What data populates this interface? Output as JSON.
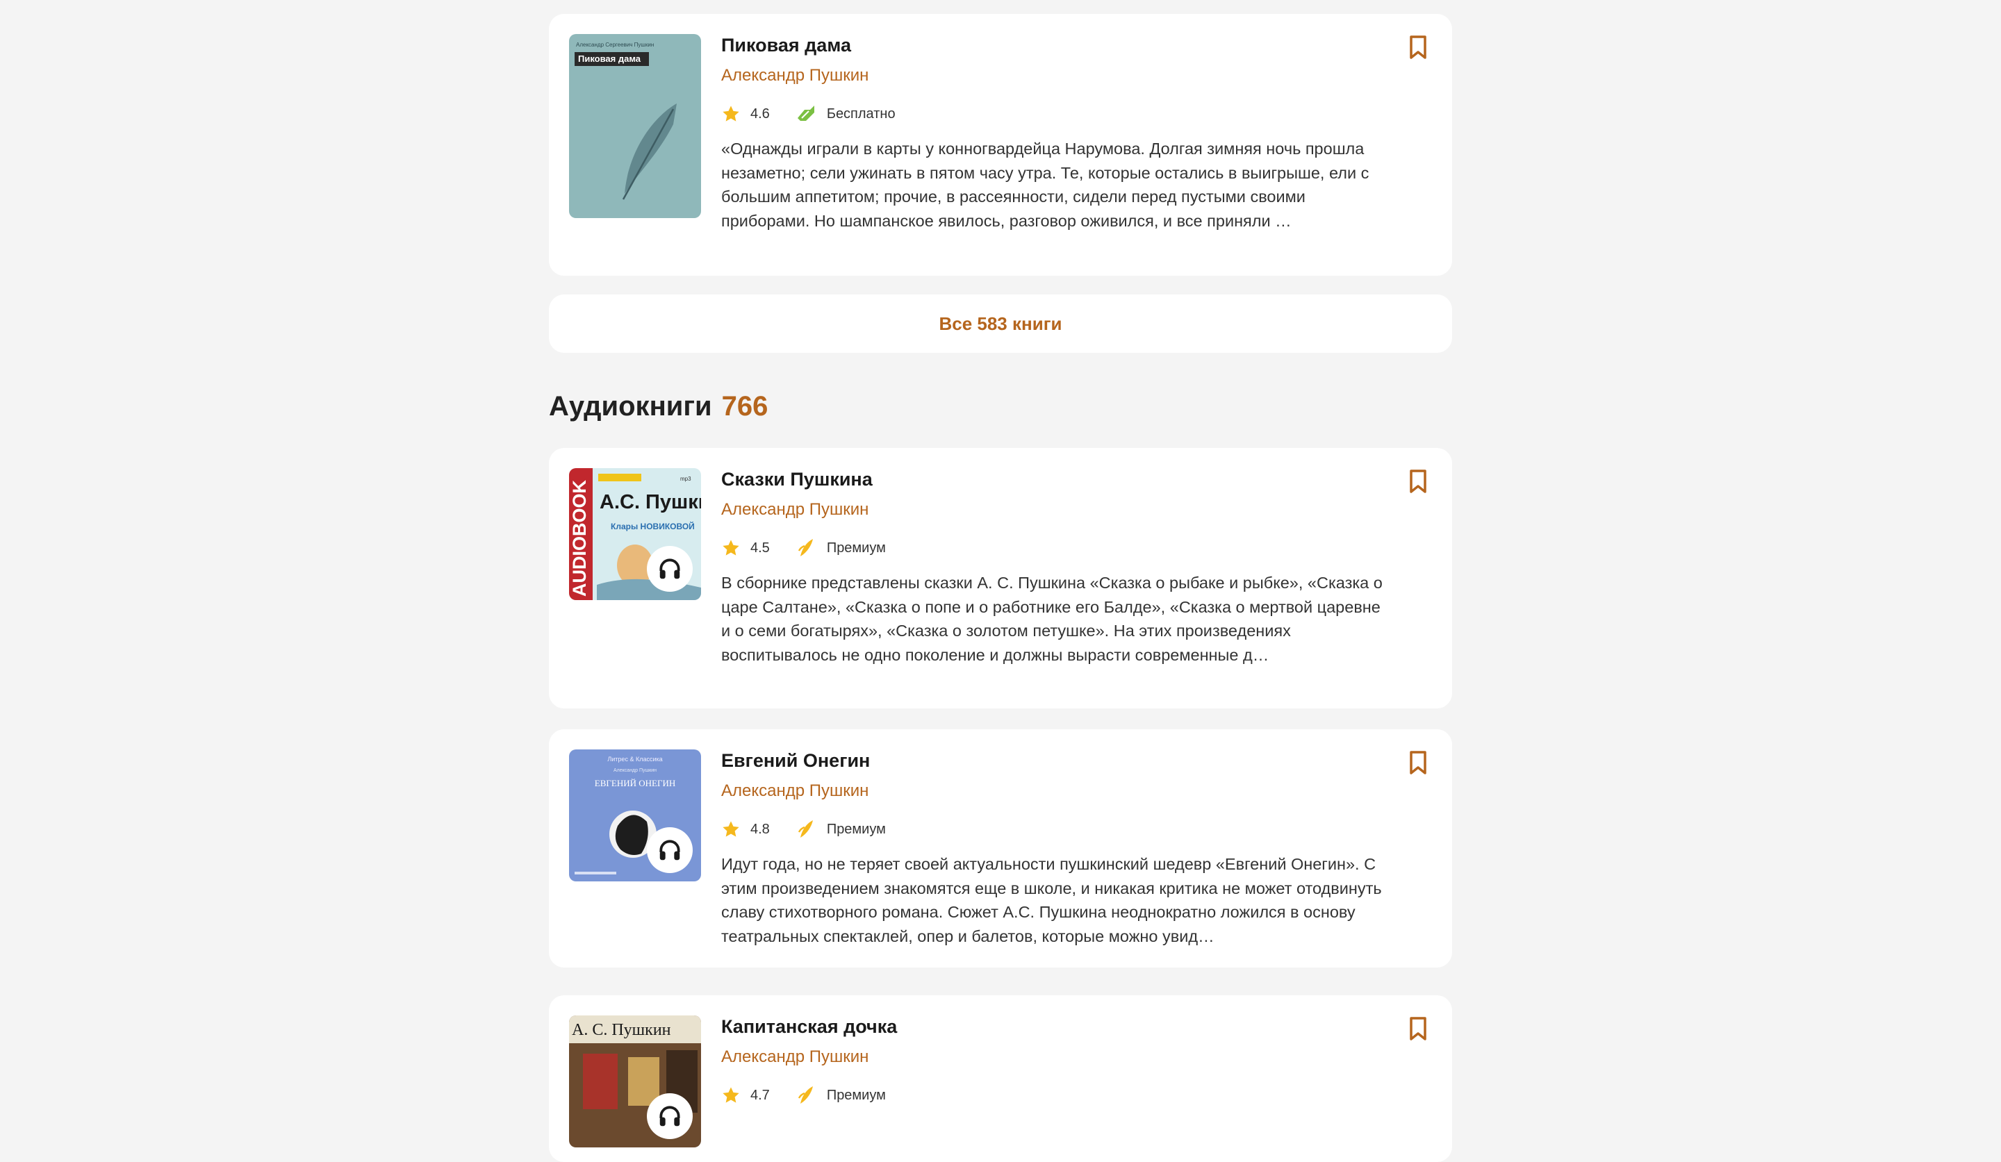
{
  "colors": {
    "accent": "#b5651d",
    "star": "#f5b81d",
    "free_badge": "#7bc043",
    "premium_badge": "#f5b81d",
    "background": "#f4f4f4"
  },
  "books_section": {
    "book": {
      "title": "Пиковая дама",
      "author": "Александр Пушкин",
      "rating": "4.6",
      "badge_icon": "free-icon",
      "badge_label": "Бесплатно",
      "description": "«Однажды играли в карты у конногвардейца Нарумова. Долгая зимняя ночь прошла незаметно; сели ужинать в пятом часу утра. Те, которые остались в выигрыше, ели с большим аппетитом; прочие, в рассеянности, сидели перед пустыми своими приборами. Но шампанское явилось, разговор оживился, и все приняли …",
      "cover": {
        "top_text": "Александр Сергеевич Пушкин",
        "label": "Пиковая дама"
      }
    },
    "all_books_label": "Все 583 книги"
  },
  "audiobooks_section": {
    "heading": "Аудиокниги",
    "count": "766",
    "items": [
      {
        "title": "Сказки Пушкина",
        "author": "Александр Пушкин",
        "rating": "4.5",
        "badge_icon": "premium-icon",
        "badge_label": "Премиум",
        "description": "В сборнике представлены сказки А. С. Пушкина «Сказка о рыбаке и рыбке», «Сказка о царе Салтане», «Сказка о попе и о работнике его Балде», «Сказка о мертвой царевне и о семи богатырях», «Сказка о золотом петушке». На этих произведениях воспитывалось не одно поколение и должны вырасти современные д…",
        "cover": {
          "side_text": "AUDIOBOOK",
          "name": "А.С. Пушкин",
          "subtitle": "Клары НОВИКОВОЙ",
          "mp3": "mp3"
        }
      },
      {
        "title": "Евгений Онегин",
        "author": "Александр Пушкин",
        "rating": "4.8",
        "badge_icon": "premium-icon",
        "badge_label": "Премиум",
        "description": "Идут года, но не теряет своей актуальности пушкинский шедевр «Евгений Онегин». С этим произведением знакомятся еще в школе, и никакая критика не может отодвинуть славу стихотворного романа. Сюжет А.С. Пушкина неоднократно ложился в основу театральных спектаклей, опер и балетов, которые можно увид…",
        "cover": {
          "series": "Литрес & Классика",
          "author": "Александр Пушкин",
          "name": "ЕВГЕНИЙ ОНЕГИН"
        }
      },
      {
        "title": "Капитанская дочка",
        "author": "Александр Пушкин",
        "rating": "4.7",
        "badge_icon": "premium-icon",
        "badge_label": "Премиум",
        "cover": {
          "name": "А. С. Пушкин"
        }
      }
    ]
  }
}
